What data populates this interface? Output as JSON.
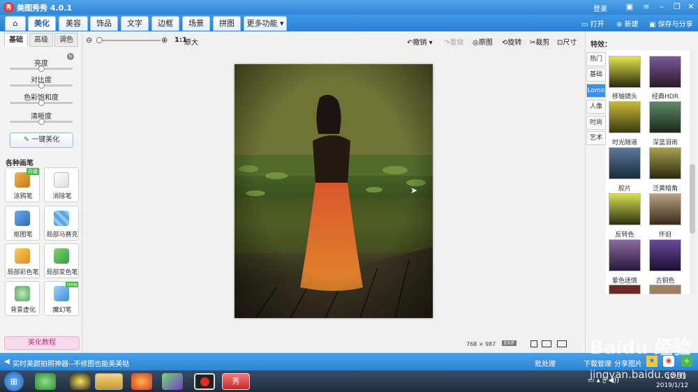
{
  "app": {
    "logo": "秀",
    "title": "美图秀秀 4.0.1",
    "login": "登录"
  },
  "menu": {
    "tabs": [
      "美化",
      "美容",
      "饰品",
      "文字",
      "边框",
      "场景",
      "拼图",
      "更多功能"
    ],
    "active": "美化"
  },
  "top_actions": {
    "open": "打开",
    "new": "新建",
    "save": "保存与分享"
  },
  "toolbar": {
    "ratio": "1:1",
    "original_size": "原大",
    "undo": "撤销",
    "redo": "重做",
    "original": "原图",
    "rotate": "旋转",
    "crop": "裁剪",
    "resize": "尺寸"
  },
  "left": {
    "subtabs": [
      "基础",
      "高级",
      "调色"
    ],
    "sliders": [
      {
        "label": "亮度",
        "value": 0.5
      },
      {
        "label": "对比度",
        "value": 0.5
      },
      {
        "label": "色彩饱和度",
        "value": 0.5
      },
      {
        "label": "清晰度",
        "value": 0.5
      }
    ],
    "one_key": "一键美化",
    "brushes_title": "各种画笔",
    "tools": [
      {
        "label": "涂鸦笔",
        "badge": "升级"
      },
      {
        "label": "消除笔",
        "badge": ""
      },
      {
        "label": "抠图笔",
        "badge": ""
      },
      {
        "label": "局部马赛克",
        "badge": ""
      },
      {
        "label": "局部彩色笔",
        "badge": ""
      },
      {
        "label": "局部变色笔",
        "badge": ""
      },
      {
        "label": "背景虚化",
        "badge": ""
      },
      {
        "label": "魔幻笔",
        "badge": "new"
      }
    ],
    "tutorial": "美化教程"
  },
  "canvas": {
    "width": "768",
    "x": "×",
    "height": "987",
    "exif": "EXIF"
  },
  "right": {
    "title": "特效：",
    "categories": [
      "热门",
      "基础",
      "Lomo",
      "人像",
      "时尚",
      "艺术"
    ],
    "active_category": "Lomo",
    "effects": [
      "移轴镜头",
      "经典HDR",
      "时光隧道",
      "深蓝泪雨",
      "胶片",
      "泛黄暗角",
      "反转色",
      "怀旧",
      "紫色迷情",
      "古铜色"
    ]
  },
  "status": {
    "text": "实时美颜拍照神器--不修图也能美美哒",
    "batch": "批处理",
    "download": "下载管理",
    "share": "分享图片"
  },
  "taskbar": {
    "time": "17:31",
    "date": "2019/1/12"
  },
  "watermark": {
    "line1": "Baidu 经验",
    "line2": "jingyan.baidu.com"
  },
  "colors": {
    "accent": "#2f86d6",
    "active_category": "#3d8fe0"
  }
}
